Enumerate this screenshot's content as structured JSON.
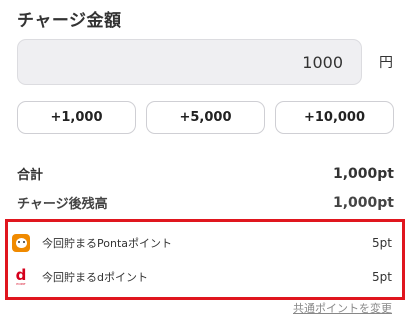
{
  "title": "チャージ金額",
  "amount": {
    "value": "1000",
    "unit": "円"
  },
  "quick_buttons": [
    "+1,000",
    "+5,000",
    "+10,000"
  ],
  "summary": {
    "total_label": "合計",
    "total_value": "1,000pt",
    "balance_label": "チャージ後残高",
    "balance_value": "1,000pt"
  },
  "points": [
    {
      "label": "今回貯まるPontaポイント",
      "value": "5pt",
      "icon": "ponta-icon"
    },
    {
      "label": "今回貯まるdポイント",
      "value": "5pt",
      "icon": "d-point-icon",
      "icon_text": "d",
      "icon_subtext": "POINT"
    }
  ],
  "link_text": "共通ポイントを変更",
  "colors": {
    "highlight": "#e0161e",
    "ponta": "#f08a00",
    "dpoint": "#d5001c"
  }
}
